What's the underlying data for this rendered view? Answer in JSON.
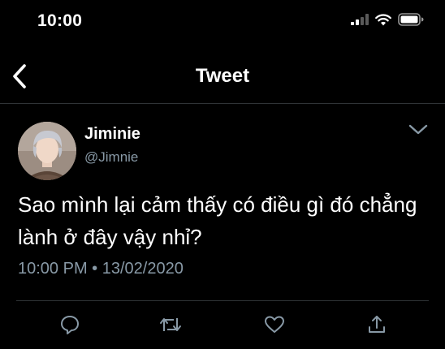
{
  "status_bar": {
    "time": "10:00",
    "icons": [
      "signal-icon",
      "wifi-icon",
      "battery-icon"
    ]
  },
  "nav": {
    "title": "Tweet",
    "back_icon": "back-arrow-icon"
  },
  "tweet": {
    "author_name": "Jiminie",
    "author_handle": "@Jimnie",
    "text": "Sao mình lại cảm thấy có điều gì đó chẳng lành ở đây vậy nhỉ?",
    "time": "10:00 PM",
    "separator": "•",
    "date": "13/02/2020"
  },
  "actions": [
    "reply-icon",
    "retweet-icon",
    "like-icon",
    "share-icon"
  ],
  "colors": {
    "background": "#000000",
    "text": "#ffffff",
    "secondary_text": "#8899a6",
    "icon": "#8899a6",
    "divider": "#2f3336"
  }
}
